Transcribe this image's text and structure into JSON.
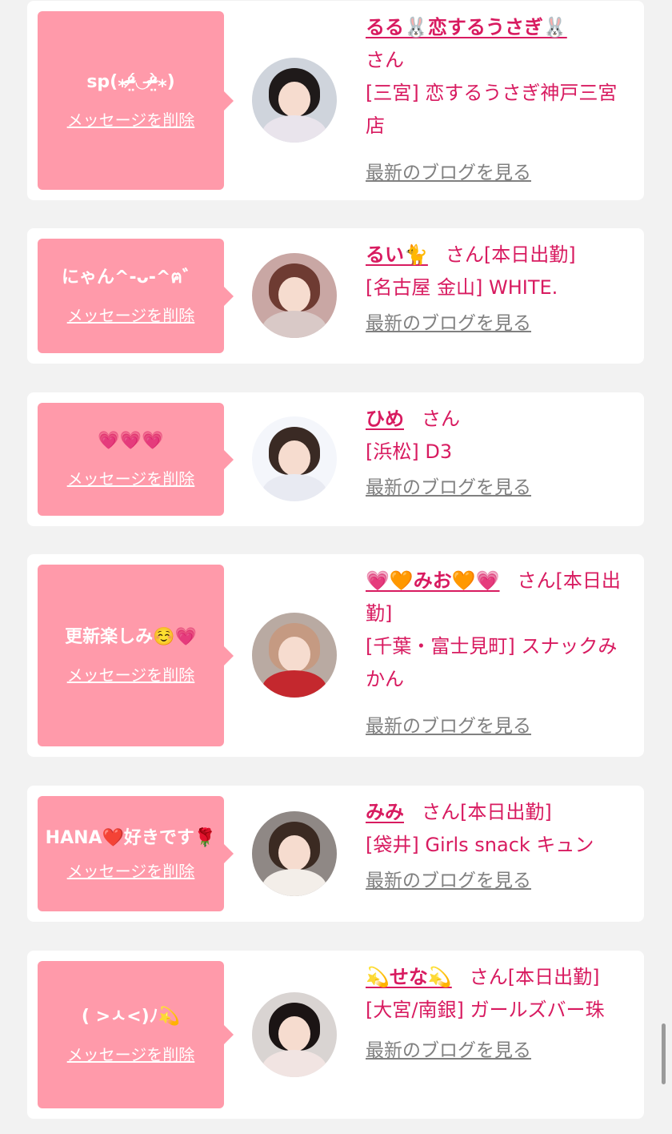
{
  "delete_label": "メッセージを削除",
  "blog_label": "最新のブログを見る",
  "san": "さん",
  "cards": [
    {
      "message": "sp(⁎ᵒ̴̶̷̤́◡ᵒ̴̶̷̤̀⁎)",
      "name": "るる🐰恋するうさぎ🐰",
      "status": "",
      "shop": "[三宮] 恋するうさぎ神戸三宮店",
      "avatar_icon": "girl-portrait-icon",
      "avatar_colors": {
        "bg": "#cfd4dc",
        "hair": "#1f1a1a",
        "body": "#e9e4ec"
      }
    },
    {
      "message": "にゃん^-ᴗ-^ฅ゛",
      "name": "るい🐈",
      "status": "[本日出勤]",
      "shop": "[名古屋 金山] WHITE.",
      "avatar_icon": "girl-portrait-icon",
      "avatar_colors": {
        "bg": "#c9a7a4",
        "hair": "#6e3b32",
        "body": "#d9c9c7"
      }
    },
    {
      "message": "💗💗💗",
      "name": "ひめ",
      "status": "",
      "shop": "[浜松] D3",
      "avatar_icon": "girl-portrait-icon",
      "avatar_colors": {
        "bg": "#f4f6fb",
        "hair": "#3a2a24",
        "body": "#e8eaf2"
      }
    },
    {
      "message": "更新楽しみ☺️💗",
      "name": "💗🧡みお🧡💗",
      "status": "[本日出勤]",
      "shop": "[千葉・富士見町] スナックみかん",
      "avatar_icon": "girl-portrait-icon",
      "avatar_colors": {
        "bg": "#b9aaa2",
        "hair": "#c59a82",
        "body": "#c4282e"
      }
    },
    {
      "message": "HANA❤️好きです🌹",
      "name": "みみ",
      "status": "[本日出勤]",
      "shop": "[袋井] Girls snack キュン",
      "avatar_icon": "girl-portrait-icon",
      "avatar_colors": {
        "bg": "#8f8885",
        "hair": "#3b2a22",
        "body": "#f3eee9"
      }
    },
    {
      "message": "( >ㅅ<)ﾉ💫",
      "name": "💫せな💫",
      "status": "[本日出勤]",
      "shop": "[大宮/南銀] ガールズバー珠",
      "avatar_icon": "girl-portrait-icon",
      "avatar_colors": {
        "bg": "#d9d4d2",
        "hair": "#1b1414",
        "body": "#f1e4e2"
      }
    }
  ]
}
